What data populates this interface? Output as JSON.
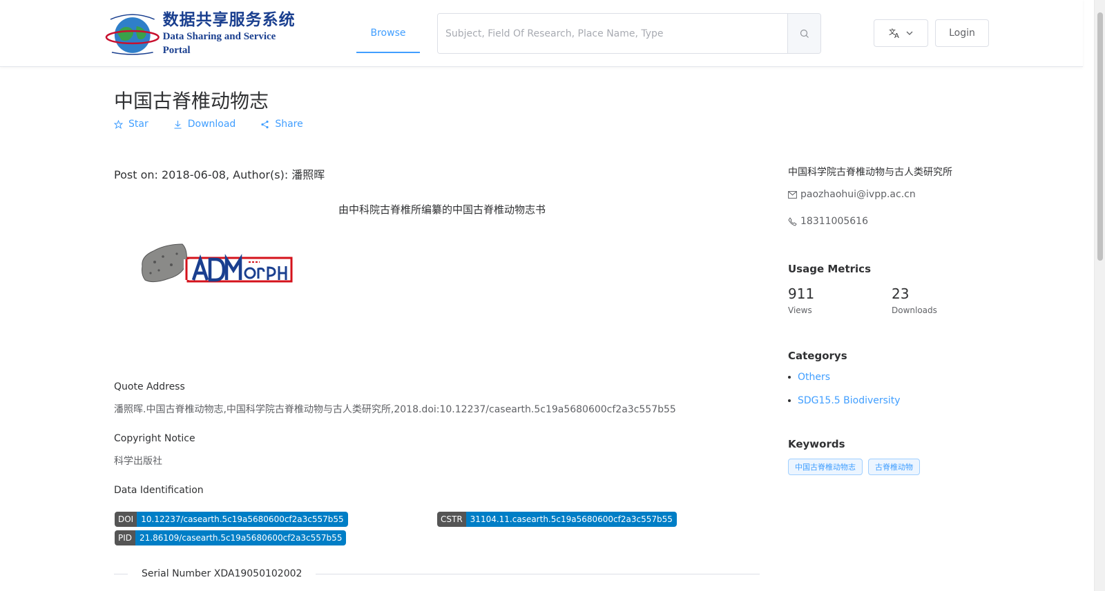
{
  "header": {
    "logo_cn": "数据共享服务系统",
    "logo_en": "Data Sharing and Service Portal",
    "nav_browse": "Browse",
    "search_placeholder": "Subject, Field Of Research, Place Name, Type",
    "login": "Login",
    "lang_icon": "translate-icon"
  },
  "dataset": {
    "title": "中国古脊椎动物志",
    "actions": {
      "star": "Star",
      "download": "Download",
      "share": "Share"
    },
    "meta": "Post on: 2018-06-08, Author(s): 潘照晖",
    "description": "由中科院古脊椎所编纂的中国古脊椎动物志书",
    "image_logo_text": "ADMorph",
    "quote_label": "Quote Address",
    "quote_value": "潘照晖.中国古脊椎动物志,中国科学院古脊椎动物与古人类研究所,2018.doi:10.12237/casearth.5c19a5680600cf2a3c557b55",
    "copyright_label": "Copyright Notice",
    "copyright_value": "科学出版社",
    "identification_label": "Data Identification",
    "ids": {
      "doi_key": "DOI",
      "doi_value": "10.12237/casearth.5c19a5680600cf2a3c557b55",
      "cstr_key": "CSTR",
      "cstr_value": "31104.11.casearth.5c19a5680600cf2a3c557b55",
      "pid_key": "PID",
      "pid_value": "21.86109/casearth.5c19a5680600cf2a3c557b55"
    },
    "serial": "Serial Number XDA19050102002"
  },
  "sidebar": {
    "org": "中国科学院古脊椎动物与古人类研究所",
    "email": "paozhaohui@ivpp.ac.cn",
    "phone": "18311005616",
    "usage_title": "Usage Metrics",
    "views_num": "911",
    "views_label": "Views",
    "downloads_num": "23",
    "downloads_label": "Downloads",
    "categories_title": "Categorys",
    "categories": [
      "Others",
      "SDG15.5 Biodiversity"
    ],
    "keywords_title": "Keywords",
    "keywords": [
      "中国古脊椎动物志",
      "古脊椎动物"
    ]
  },
  "colors": {
    "accent": "#409eff",
    "badge_key": "#555555",
    "badge_value": "#007ec6",
    "logo": "#1a3f8f"
  }
}
